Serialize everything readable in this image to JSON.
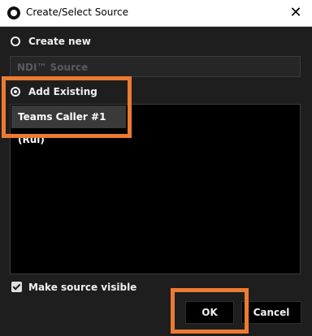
{
  "window": {
    "title": "Create/Select Source",
    "close_glyph": "✕"
  },
  "options": {
    "create_new_label": "Create new",
    "ndi_source_placeholder": "NDI™ Source",
    "add_existing_label": "Add Existing"
  },
  "existing_sources": [
    "Teams Caller #1 (Rui)"
  ],
  "make_visible": {
    "label": "Make source visible",
    "checked": true
  },
  "buttons": {
    "ok": "OK",
    "cancel": "Cancel"
  },
  "highlight_color": "#ec7b32"
}
